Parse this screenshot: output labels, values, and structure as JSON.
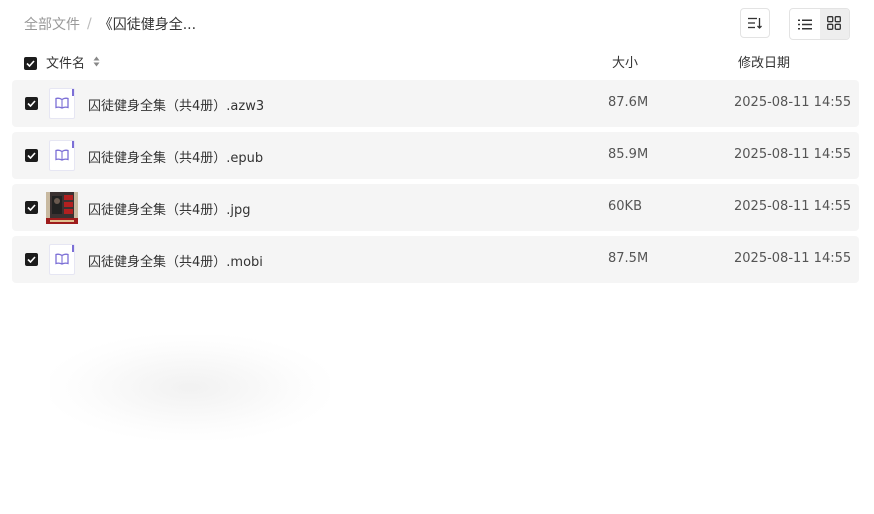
{
  "breadcrumb": {
    "root": "全部文件",
    "separator": "/",
    "current": "《囚徒健身全..."
  },
  "toolbar": {
    "sort_icon": "sort-icon",
    "list_view_icon": "list-view-icon",
    "grid_view_icon": "grid-view-icon",
    "active_view": "grid"
  },
  "table": {
    "headers": {
      "name": "文件名",
      "size": "大小",
      "date": "修改日期"
    },
    "rows": [
      {
        "name": "囚徒健身全集（共4册）.azw3",
        "size": "87.6M",
        "date": "2025-08-11 14:55",
        "type": "ebook",
        "checked": true
      },
      {
        "name": "囚徒健身全集（共4册）.epub",
        "size": "85.9M",
        "date": "2025-08-11 14:55",
        "type": "ebook",
        "checked": true
      },
      {
        "name": "囚徒健身全集（共4册）.jpg",
        "size": "60KB",
        "date": "2025-08-11 14:55",
        "type": "image",
        "checked": true
      },
      {
        "name": "囚徒健身全集（共4册）.mobi",
        "size": "87.5M",
        "date": "2025-08-11 14:55",
        "type": "ebook",
        "checked": true
      }
    ]
  },
  "colors": {
    "row_background": "#f5f5f5",
    "checkbox": "#1c1c1c",
    "ebook_icon_accent": "#7c6fd6"
  }
}
